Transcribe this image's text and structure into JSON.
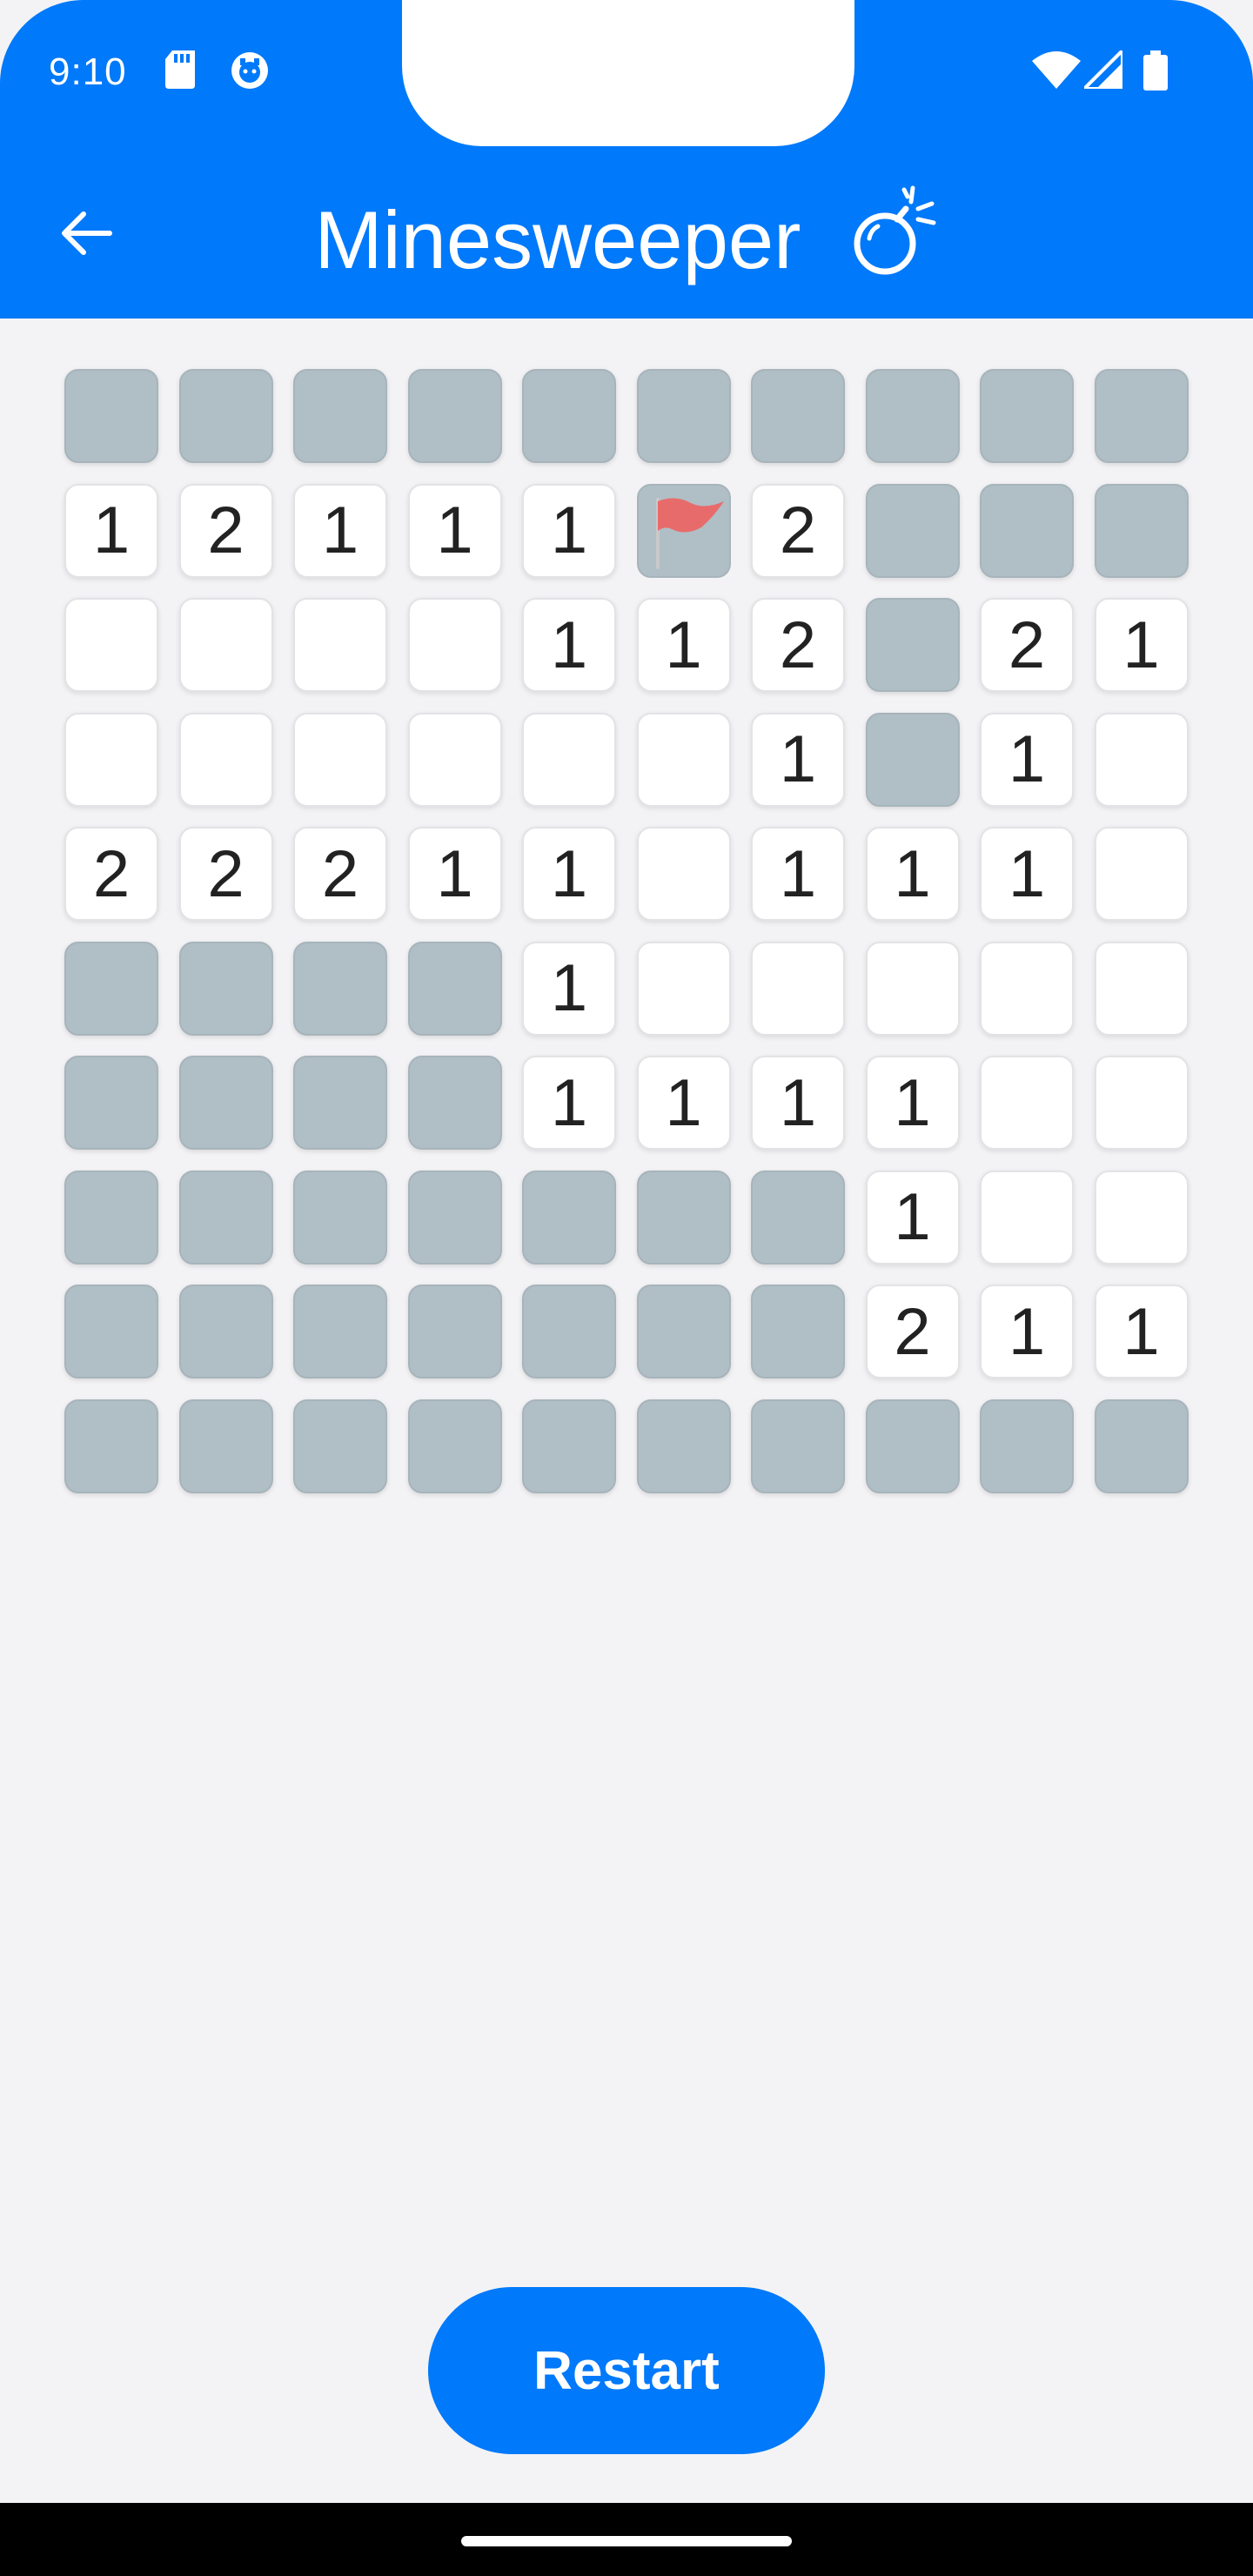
{
  "status_bar": {
    "time": "9:10",
    "left_icons": [
      "sd-card-icon",
      "notification-icon"
    ],
    "right_icons": [
      "wifi-icon",
      "cellular-signal-icon",
      "battery-icon"
    ]
  },
  "app_bar": {
    "title": "Minesweeper",
    "title_icon": "bomb-icon",
    "back_icon": "arrow-back-icon"
  },
  "board": {
    "rows": 10,
    "cols": 10,
    "cells": [
      [
        "H",
        "H",
        "H",
        "H",
        "H",
        "H",
        "H",
        "H",
        "H",
        "H"
      ],
      [
        "1",
        "2",
        "1",
        "1",
        "1",
        "F",
        "2",
        "H",
        "H",
        "H"
      ],
      [
        "",
        "",
        "",
        "",
        "1",
        "1",
        "2",
        "H",
        "2",
        "1"
      ],
      [
        "",
        "",
        "",
        "",
        "",
        "",
        "1",
        "H",
        "1",
        ""
      ],
      [
        "2",
        "2",
        "2",
        "1",
        "1",
        "",
        "1",
        "1",
        "1",
        ""
      ],
      [
        "H",
        "H",
        "H",
        "H",
        "1",
        "",
        "",
        "",
        "",
        ""
      ],
      [
        "H",
        "H",
        "H",
        "H",
        "1",
        "1",
        "1",
        "1",
        "",
        ""
      ],
      [
        "H",
        "H",
        "H",
        "H",
        "H",
        "H",
        "H",
        "1",
        "",
        ""
      ],
      [
        "H",
        "H",
        "H",
        "H",
        "H",
        "H",
        "H",
        "2",
        "1",
        "1"
      ],
      [
        "H",
        "H",
        "H",
        "H",
        "H",
        "H",
        "H",
        "H",
        "H",
        "H"
      ]
    ],
    "legend": {
      "H": "hidden",
      "F": "flagged",
      "": "revealed-empty"
    },
    "flag_icon": "red-flag-icon"
  },
  "actions": {
    "restart_label": "Restart"
  },
  "colors": {
    "primary": "#0079fa",
    "hidden_cell": "#b0bec5",
    "revealed_cell": "#ffffff",
    "background": "#f3f3f5",
    "number_text": "#222222",
    "flag": "#e86b6b"
  }
}
